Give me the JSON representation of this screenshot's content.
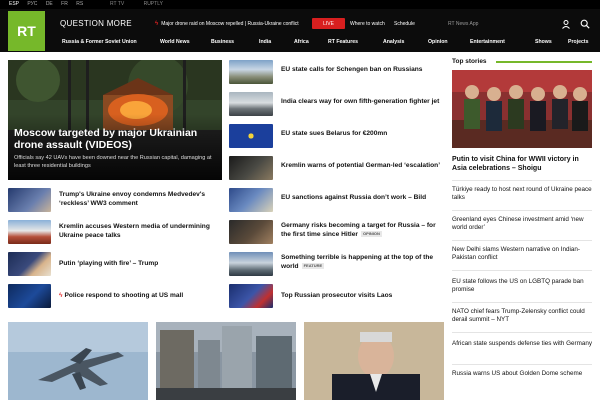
{
  "topbar": {
    "langs": [
      "ESP",
      "РУС",
      "DE",
      "FR",
      "RS"
    ],
    "extras": [
      "RT TV",
      "RUPTLY"
    ],
    "rtnews_app": "RT News App"
  },
  "header": {
    "logo": "RT",
    "question_more": "QUESTION MORE",
    "breaking": "Major drone raid on Moscow repelled | Russia-Ukraine conflict",
    "live": "LIVE",
    "where_to_watch": "Where to watch",
    "schedule": "Schedule"
  },
  "nav": [
    "Russia & Former Soviet Union",
    "World News",
    "Business",
    "India",
    "Africa",
    "RT Features",
    "Analysis",
    "Opinion",
    "Entertainment",
    "Shows",
    "Projects"
  ],
  "hero": {
    "title": "Moscow targeted by major Ukrainian drone assault (VIDEOS)",
    "subtitle": "Officials say 42 UAVs have been downed near the Russian capital, damaging at least three residential buildings"
  },
  "left_news": [
    "Trump's Ukraine envoy condemns Medvedev's ‘reckless’ WW3 comment",
    "Kremlin accuses Western media of undermining Ukraine peace talks",
    "Putin ‘playing with fire’ – Trump",
    "Police respond to shooting at US mall"
  ],
  "mid_news": [
    {
      "text": "EU state calls for Schengen ban on Russians",
      "tag": ""
    },
    {
      "text": "India clears way for own fifth-generation fighter jet",
      "tag": ""
    },
    {
      "text": "EU state sues Belarus for €200mn",
      "tag": ""
    },
    {
      "text": "Kremlin warns of potential German-led ‘escalation’",
      "tag": ""
    },
    {
      "text": "EU sanctions against Russia don’t work – Bild",
      "tag": ""
    },
    {
      "text": "Germany risks becoming a target for Russia – for the first time since Hitler",
      "tag": "OPINION"
    },
    {
      "text": "Something terrible is happening at the top of the world",
      "tag": "FEATURE"
    },
    {
      "text": "Top Russian prosecutor visits Laos",
      "tag": ""
    }
  ],
  "top_stories": {
    "heading": "Top stories",
    "main": "Putin to visit China for WWII victory in Asia celebrations – Shoigu",
    "items": [
      "Türkiye ready to host next round of Ukraine peace talks",
      "Greenland eyes Chinese investment amid ‘new world order’",
      "New Delhi slams Western narrative on Indian-Pakistan conflict",
      "EU state follows the US on LGBTQ parade ban promise",
      "NATO chief fears Trump-Zelensky conflict could derail summit – NYT",
      "African state suspends defense ties with Germany",
      "Russia warns US about Golden Dome scheme"
    ]
  },
  "colors": {
    "brand": "#76b82a",
    "live": "#d81f1f",
    "header": "#0c0c0c"
  }
}
